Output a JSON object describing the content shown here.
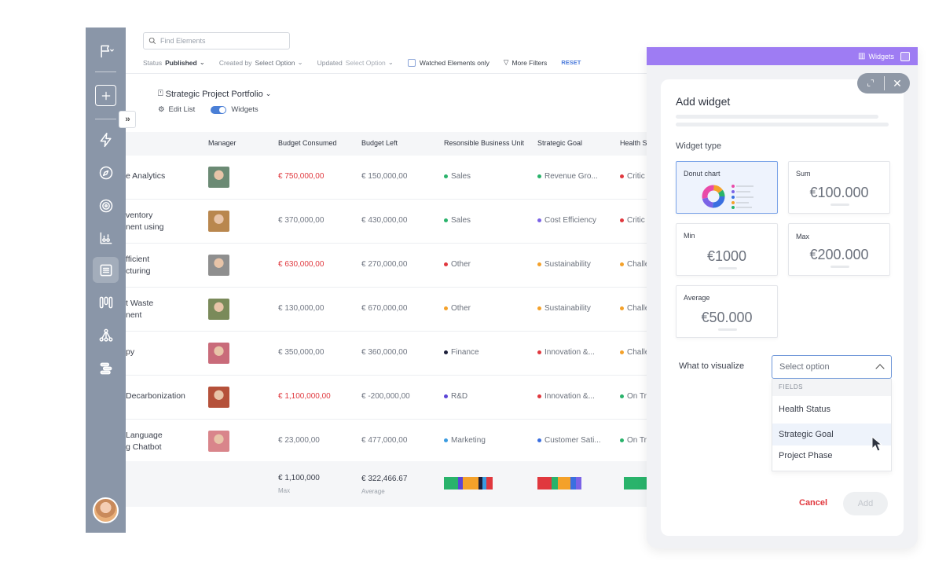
{
  "search": {
    "placeholder": "Find Elements"
  },
  "filters": {
    "status_label": "Status",
    "status_value": "Published",
    "created_label": "Created by",
    "created_value": "Select Option",
    "updated_label": "Updated",
    "updated_value": "Select Option",
    "watched_label": "Watched Elements only",
    "more_filters": "More Filters",
    "reset": "RESET"
  },
  "collapse_label": "››",
  "list": {
    "title": "Strategic Project Portfolio",
    "edit_list": "Edit List",
    "widgets_toggle": "Widgets"
  },
  "table": {
    "headers": [
      "Manager",
      "Budget Consumed",
      "Budget Left",
      "Resonsible Business Unit",
      "Strategic Goal",
      "Health S"
    ],
    "rows": [
      {
        "name1": "e Analytics",
        "name2": "",
        "consumed": "€ 750,000,00",
        "consumed_red": true,
        "left": "€ 150,000,00",
        "bu": "Sales",
        "bu_color": "#29b36b",
        "goal": "Revenue Gro...",
        "goal_color": "#29b36b",
        "health": "Critic",
        "health_color": "#e0383e",
        "face": "#6b8a74"
      },
      {
        "name1": "ventory",
        "name2": "nent using",
        "consumed": "€ 370,000,00",
        "consumed_red": false,
        "left": "€ 430,000,00",
        "bu": "Sales",
        "bu_color": "#29b36b",
        "goal": "Cost Efficiency",
        "goal_color": "#7b63e6",
        "health": "Critic",
        "health_color": "#e0383e",
        "face": "#b9874e"
      },
      {
        "name1": "fficient",
        "name2": "cturing",
        "consumed": "€ 630,000,00",
        "consumed_red": true,
        "left": "€ 270,000,00",
        "bu": "Other",
        "bu_color": "#e0383e",
        "goal": "Sustainability",
        "goal_color": "#f4a12a",
        "health": "Challe",
        "health_color": "#f4a12a",
        "face": "#8f8f8f"
      },
      {
        "name1": "t Waste",
        "name2": "nent",
        "consumed": "€ 130,000,00",
        "consumed_red": false,
        "left": "€ 670,000,00",
        "bu": "Other",
        "bu_color": "#f4a12a",
        "goal": "Sustainability",
        "goal_color": "#f4a12a",
        "health": "Challe",
        "health_color": "#f4a12a",
        "face": "#7a8a5a"
      },
      {
        "name1": "py",
        "name2": "",
        "consumed": "€ 350,000,00",
        "consumed_red": false,
        "left": "€ 360,000,00",
        "bu": "Finance",
        "bu_color": "#1c1f3a",
        "goal": "Innovation &...",
        "goal_color": "#e0383e",
        "health": "Challe",
        "health_color": "#f4a12a",
        "face": "#c96b7a"
      },
      {
        "name1": "Decarbonization",
        "name2": "",
        "consumed": "€ 1,100,000,00",
        "consumed_red": true,
        "left": "€ -200,000,00",
        "bu": "R&D",
        "bu_color": "#5b45d6",
        "goal": "Innovation &...",
        "goal_color": "#e0383e",
        "health": "On Tr",
        "health_color": "#29b36b",
        "face": "#b5513a"
      },
      {
        "name1": "Language",
        "name2": "g Chatbot",
        "consumed": "€ 23,000,00",
        "consumed_red": false,
        "left": "€ 477,000,00",
        "bu": "Marketing",
        "bu_color": "#3a9be0",
        "goal": "Customer Sati...",
        "goal_color": "#3a6fe0",
        "health": "On Tr",
        "health_color": "#29b36b",
        "face": "#d9858b"
      }
    ],
    "footer": {
      "consumed": "€ 1,100,000",
      "consumed_sub": "Max",
      "left": "€ 322,466.67",
      "left_sub": "Average"
    }
  },
  "widget_panel": {
    "header_label": "Widgets",
    "title": "Add widget",
    "type_label": "Widget type",
    "tiles": {
      "donut": {
        "label": "Donut chart"
      },
      "sum": {
        "label": "Sum",
        "value": "€100.000"
      },
      "min": {
        "label": "Min",
        "value": "€1000"
      },
      "max": {
        "label": "Max",
        "value": "€200.000"
      },
      "average": {
        "label": "Average",
        "value": "€50.000"
      }
    },
    "visualize_label": "What to visualize",
    "select_placeholder": "Select option",
    "dropdown": {
      "group": "FIELDS",
      "options": [
        "Health Status",
        "Strategic Goal",
        "Project Phase"
      ],
      "highlighted": "Strategic Goal"
    },
    "cancel": "Cancel",
    "add": "Add"
  }
}
